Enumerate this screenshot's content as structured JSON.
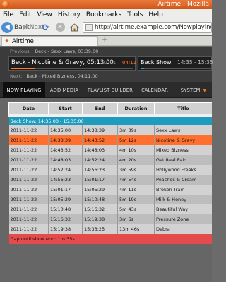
{
  "window": {
    "title": "Airtime - Mozilla"
  },
  "menu": [
    "File",
    "Edit",
    "View",
    "History",
    "Bookmarks",
    "Tools",
    "Help"
  ],
  "nav": {
    "back_label": "Back",
    "forward_label": "Next",
    "url": "http://airtime.example.com/Nowplaying/index"
  },
  "tab": {
    "title": "Airtime",
    "new_tab_symbol": "+"
  },
  "player": {
    "previous_label": "Previous:",
    "previous_track": "Beck - Sexx Laws, 03:39.00",
    "current_track": "Beck - Nicotine & Gravy, 05:13.00",
    "elapsed": "01:01",
    "remaining": "04:11",
    "track_progress_percent": 20,
    "next_label": "Next:",
    "next_track": "Beck - Mixed Bizness, 04:11.00",
    "show_name": "Beck Show",
    "show_time": "14:35 - 15:35",
    "show_progress_percent": 5
  },
  "appnav": {
    "now_playing": "NOW PLAYING",
    "add_media": "ADD MEDIA",
    "playlist_builder": "PLAYLIST BUILDER",
    "calendar": "CALENDAR",
    "system": "SYSTEM"
  },
  "table": {
    "headers": [
      "Date",
      "Start",
      "End",
      "Duration",
      "Title"
    ],
    "show_header": "Beck Show: 14:35:00 - 15:35:00",
    "rows": [
      [
        "2011-11-22",
        "14:35:00",
        "14:38:39",
        "3m 39s",
        "Sexx Laws"
      ],
      [
        "2011-11-22",
        "14:38:39",
        "14:43:52",
        "5m 12s",
        "Nicotine & Gravy"
      ],
      [
        "2011-11-22",
        "14:43:52",
        "14:48:03",
        "4m 10s",
        "Mixed Bizness"
      ],
      [
        "2011-11-22",
        "14:48:03",
        "14:52:24",
        "4m 20s",
        "Get Real Paid"
      ],
      [
        "2011-11-22",
        "14:52:24",
        "14:56:23",
        "3m 59s",
        "Hollywood Freaks"
      ],
      [
        "2011-11-22",
        "14:56:23",
        "15:01:17",
        "4m 54s",
        "Peaches & Cream"
      ],
      [
        "2011-11-22",
        "15:01:17",
        "15:05:29",
        "4m 11s",
        "Broken Train"
      ],
      [
        "2011-11-22",
        "15:05:29",
        "15:10:48",
        "5m 19s",
        "Milk & Honey"
      ],
      [
        "2011-11-22",
        "15:10:48",
        "15:16:32",
        "5m 43s",
        "Beautiful Way"
      ],
      [
        "2011-11-22",
        "15:16:32",
        "15:19:38",
        "3m 6s",
        "Pressure Zone"
      ],
      [
        "2011-11-22",
        "15:19:38",
        "15:33:25",
        "13m 46s",
        "Debra"
      ]
    ],
    "current_row_index": 1,
    "gap_text": "Gap until show end: 1m 35s"
  }
}
